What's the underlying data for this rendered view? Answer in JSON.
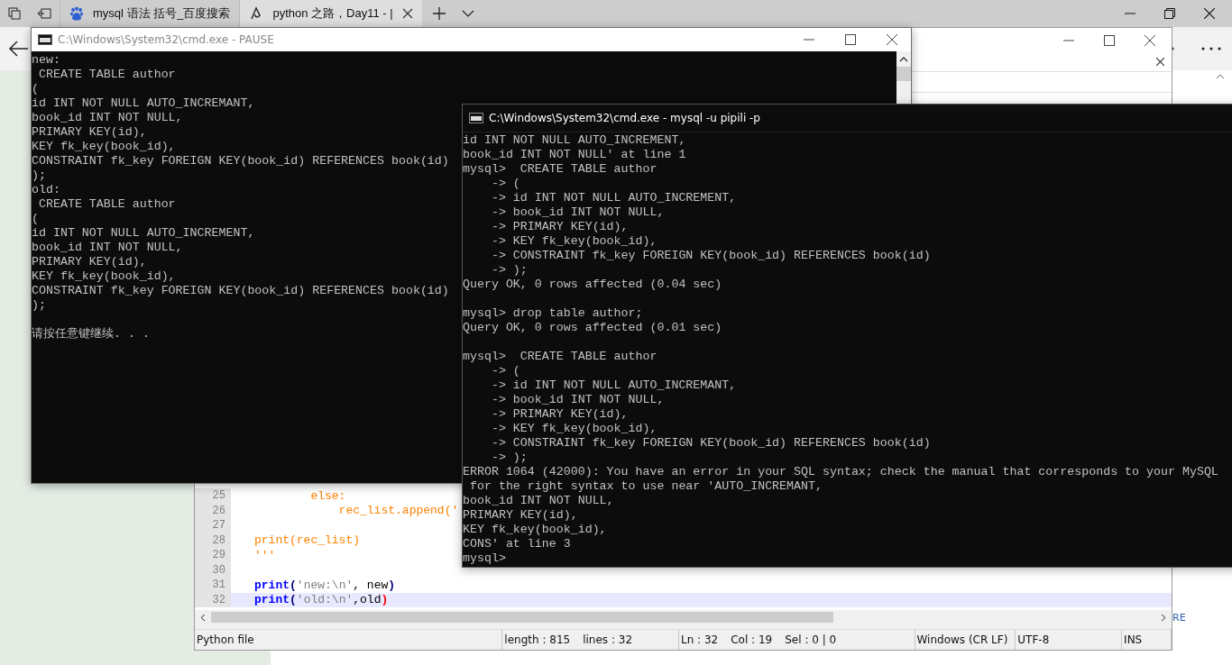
{
  "browser": {
    "tabs": [
      {
        "title": "mysql 语法 括号_百度搜索",
        "selected": false
      },
      {
        "title": "python 之路，Day11 - |",
        "selected": true
      }
    ]
  },
  "editor": {
    "lines": [
      {
        "number": "25",
        "current": false,
        "tokens": [
          {
            "kind": "docstring",
            "text": "        else:"
          }
        ]
      },
      {
        "number": "26",
        "current": false,
        "tokens": [
          {
            "kind": "docstring",
            "text": "            rec_list.append('"
          }
        ]
      },
      {
        "number": "27",
        "current": false
      },
      {
        "number": "28",
        "current": false,
        "tokens": [
          {
            "kind": "docstring",
            "text": "print(rec_list)"
          }
        ]
      },
      {
        "number": "29",
        "current": false,
        "tokens": [
          {
            "kind": "docstring",
            "text": "'''"
          }
        ]
      },
      {
        "number": "30",
        "current": false
      },
      {
        "number": "31",
        "current": false,
        "tokens": [
          {
            "kind": "keyword",
            "text": "print"
          },
          {
            "kind": "op",
            "text": "("
          },
          {
            "kind": "string",
            "text": "'new:\\n'"
          },
          {
            "kind": "plain",
            "text": ", new"
          },
          {
            "kind": "op",
            "text": ")"
          }
        ]
      },
      {
        "number": "32",
        "current": true,
        "tokens": [
          {
            "kind": "keyword",
            "text": "print"
          },
          {
            "kind": "op",
            "text": "("
          },
          {
            "kind": "string",
            "text": "'old:\\n'"
          },
          {
            "kind": "plain",
            "text": ",old"
          },
          {
            "kind": "brace_match",
            "text": ")"
          }
        ]
      }
    ],
    "status_bar": [
      {
        "items": [
          "Python file"
        ]
      },
      {
        "items": [
          "length : 815",
          "lines : 32"
        ]
      },
      {
        "items": [
          "Ln : 32",
          "Col : 19",
          "Sel : 0 | 0"
        ]
      },
      {
        "items": [
          "Windows (CR LF)"
        ]
      },
      {
        "items": [
          "UTF-8"
        ]
      },
      {
        "items": [
          "INS"
        ]
      }
    ]
  },
  "console_pause": {
    "title": "C:\\Windows\\System32\\cmd.exe - PAUSE",
    "blocks": [
      [
        "new:",
        " CREATE TABLE author",
        "(",
        "id INT NOT NULL AUTO_INCREMANT,",
        "book_id INT NOT NULL,",
        "PRIMARY KEY(id),",
        "KEY fk_key(book_id),",
        "CONSTRAINT fk_key FOREIGN KEY(book_id) REFERENCES book(id)",
        ");",
        "old:",
        " CREATE TABLE author",
        "(",
        "id INT NOT NULL AUTO_INCREMENT,",
        "book_id INT NOT NULL,",
        "PRIMARY KEY(id),",
        "KEY fk_key(book_id),",
        "CONSTRAINT fk_key FOREIGN KEY(book_id) REFERENCES book(id)",
        ");"
      ],
      [
        "请按任意键继续. . ."
      ]
    ]
  },
  "console_mysql": {
    "title": "C:\\Windows\\System32\\cmd.exe - mysql  -u pipili -p",
    "blocks": [
      [
        "id INT NOT NULL AUTO_INCREMENT,",
        "book_id INT NOT NULL' at line 1",
        "mysql>  CREATE TABLE author",
        "    -> (",
        "    -> id INT NOT NULL AUTO_INCREMENT,",
        "    -> book_id INT NOT NULL,",
        "    -> PRIMARY KEY(id),",
        "    -> KEY fk_key(book_id),",
        "    -> CONSTRAINT fk_key FOREIGN KEY(book_id) REFERENCES book(id)",
        "    -> );",
        "Query OK, 0 rows affected (0.04 sec)"
      ],
      [
        "mysql> drop table author;",
        "Query OK, 0 rows affected (0.01 sec)"
      ],
      [
        "mysql>  CREATE TABLE author",
        "    -> (",
        "    -> id INT NOT NULL AUTO_INCREMANT,",
        "    -> book_id INT NOT NULL,",
        "    -> PRIMARY KEY(id),",
        "    -> KEY fk_key(book_id),",
        "    -> CONSTRAINT fk_key FOREIGN KEY(book_id) REFERENCES book(id)",
        "    -> );",
        "ERROR 1064 (42000): You have an error in your SQL syntax; check the manual that corresponds to your MySQL",
        " for the right syntax to use near 'AUTO_INCREMANT,",
        "book_id INT NOT NULL,",
        "PRIMARY KEY(id),",
        "KEY fk_key(book_id),",
        "CONS' at line 3",
        "mysql>"
      ]
    ]
  },
  "page_fragment": "RE"
}
